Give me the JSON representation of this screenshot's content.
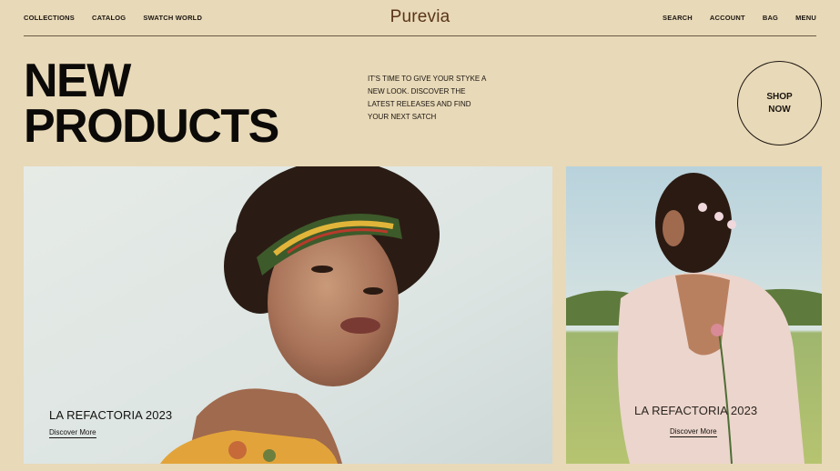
{
  "nav": {
    "left": [
      "COLLECTIONS",
      "CATALOG",
      "SWATCH WORLD"
    ],
    "right": [
      "SEARCH",
      "ACCOUNT",
      "BAG",
      "MENU"
    ],
    "logo": "Purevia"
  },
  "hero": {
    "title_line1": "NEW",
    "title_line2": "PRODUCTS",
    "text": "IT'S TIME TO GIVE YOUR STYKE A NEW LOOK. DISCOVER THE LATEST RELEASES AND FIND YOUR NEXT SATCH",
    "button_line1": "SHOP",
    "button_line2": "NOW"
  },
  "cards": [
    {
      "title": "LA REFACTORIA 2023",
      "link": "Discover More"
    },
    {
      "title": "LA REFACTORIA 2023",
      "link": "Discover More"
    }
  ]
}
